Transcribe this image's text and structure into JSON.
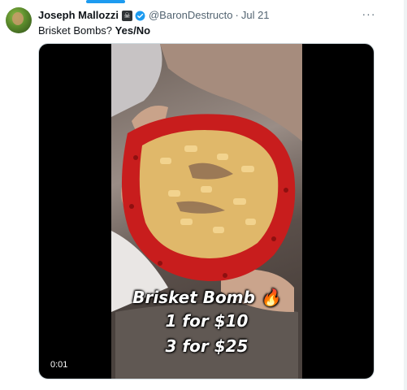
{
  "author": {
    "name": "Joseph Mallozzi",
    "handle": "@BaronDestructo",
    "time": "Jul 21",
    "separator": "·",
    "pirate_badge": "☠",
    "verified_color": "#1d9bf0"
  },
  "tweet": {
    "text_plain": "Brisket Bombs?",
    "text_bold": "Yes/No"
  },
  "more": "···",
  "video": {
    "overlay": {
      "line1": "Brisket Bomb 🔥",
      "line2": "1 for $10",
      "line3": "3 for $25"
    },
    "timestamp": "0:01"
  },
  "colors": {
    "accent": "#1d9bf0",
    "text": "#0f1419",
    "secondary": "#536471"
  }
}
